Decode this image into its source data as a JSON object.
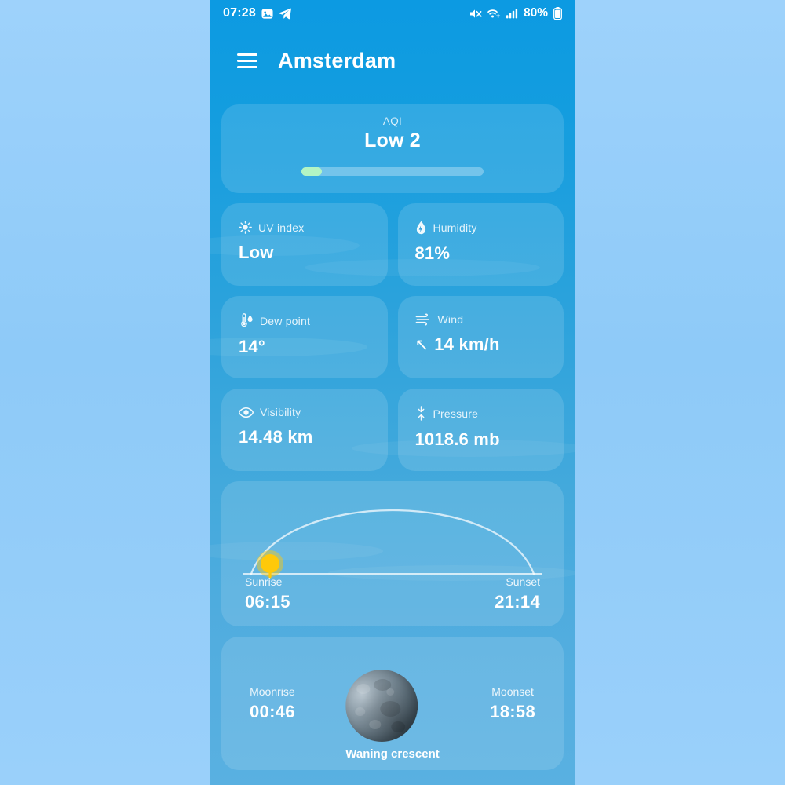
{
  "status_bar": {
    "time": "07:28",
    "battery_percent": "80%",
    "icons": [
      "photo-icon",
      "telegram-icon",
      "mute-icon",
      "wifi-icon",
      "signal-icon",
      "battery-icon"
    ]
  },
  "header": {
    "menu_icon": "hamburger-menu-icon",
    "city": "Amsterdam"
  },
  "aqi": {
    "label": "AQI",
    "value": "Low 2",
    "progress_percent": 11,
    "fill_color": "#b2f5c4",
    "track_color": "rgba(255,255,255,0.30)"
  },
  "metrics": [
    {
      "icon": "sun-icon",
      "label": "UV index",
      "value": "Low"
    },
    {
      "icon": "droplet-icon",
      "label": "Humidity",
      "value": "81%"
    },
    {
      "icon": "thermometer-droplet-icon",
      "label": "Dew point",
      "value": "14°"
    },
    {
      "icon": "wind-icon",
      "label": "Wind",
      "value": "14 km/h",
      "direction_arrow": "↖"
    },
    {
      "icon": "eye-icon",
      "label": "Visibility",
      "value": "14.48 km"
    },
    {
      "icon": "pressure-icon",
      "label": "Pressure",
      "value": "1018.6 mb"
    }
  ],
  "sun": {
    "sunrise_label": "Sunrise",
    "sunrise_time": "06:15",
    "sunset_label": "Sunset",
    "sunset_time": "21:14",
    "sun_marker_color": "#ffc90a",
    "sun_position_percent": 8
  },
  "moon": {
    "moonrise_label": "Moonrise",
    "moonrise_time": "00:46",
    "moonset_label": "Moonset",
    "moonset_time": "18:58",
    "phase": "Waning crescent"
  },
  "theme": {
    "page_background": "#8ecbf8",
    "screen_gradient_top": "#0c9ae2",
    "screen_gradient_bottom": "#59b0e1",
    "card_background": "rgba(255,255,255,0.13)",
    "text_primary": "#ffffff"
  }
}
